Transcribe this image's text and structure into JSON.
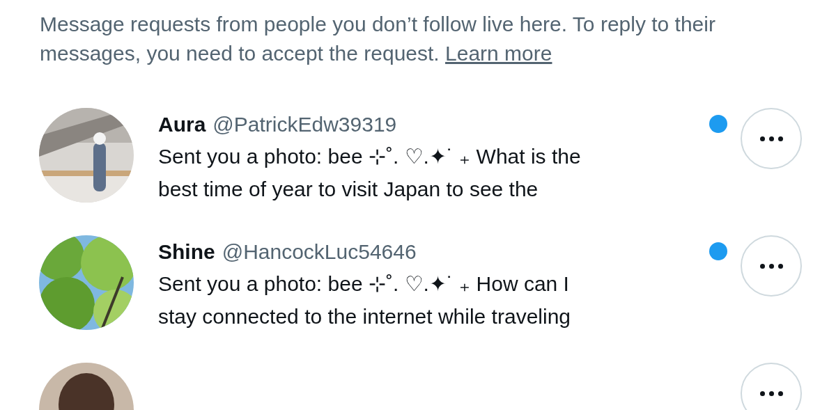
{
  "intro": {
    "text": "Message requests from people you don’t follow live here. To reply to their messages, you need to accept the request.",
    "link": "Learn more"
  },
  "conversations": [
    {
      "kind": "full",
      "name": "Aura",
      "handle": "@PatrickEdw39319",
      "unread": true,
      "preview_lines": [
        "Sent you a photo: bee ⊹˚. ♡.✦˙ ₊ What is the",
        "best time of year to visit Japan to see the"
      ]
    },
    {
      "kind": "full",
      "name": "Shine",
      "handle": "@HancockLuc54646",
      "unread": true,
      "preview_lines": [
        "Sent you a photo: bee ⊹˚. ♡.✦˙ ₊ How can I",
        "stay connected to the internet while traveling"
      ]
    },
    {
      "kind": "partial"
    }
  ]
}
